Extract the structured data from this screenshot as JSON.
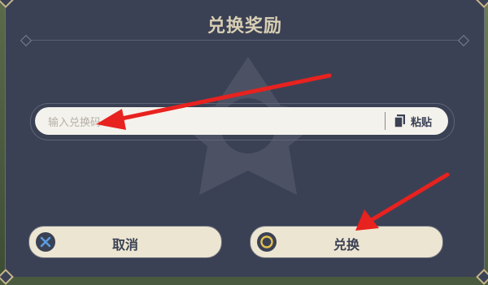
{
  "dialog": {
    "title": "兑换奖励",
    "input_placeholder": "输入兑换码",
    "paste_label": "粘贴",
    "cancel_label": "取消",
    "confirm_label": "兑换",
    "icons": [
      "cancel-x-icon",
      "confirm-circle-icon",
      "paste-clipboard-icon"
    ]
  },
  "annotation": {
    "arrow_color": "#e8221f",
    "arrows": [
      "arrow-to-input",
      "arrow-to-confirm"
    ]
  }
}
